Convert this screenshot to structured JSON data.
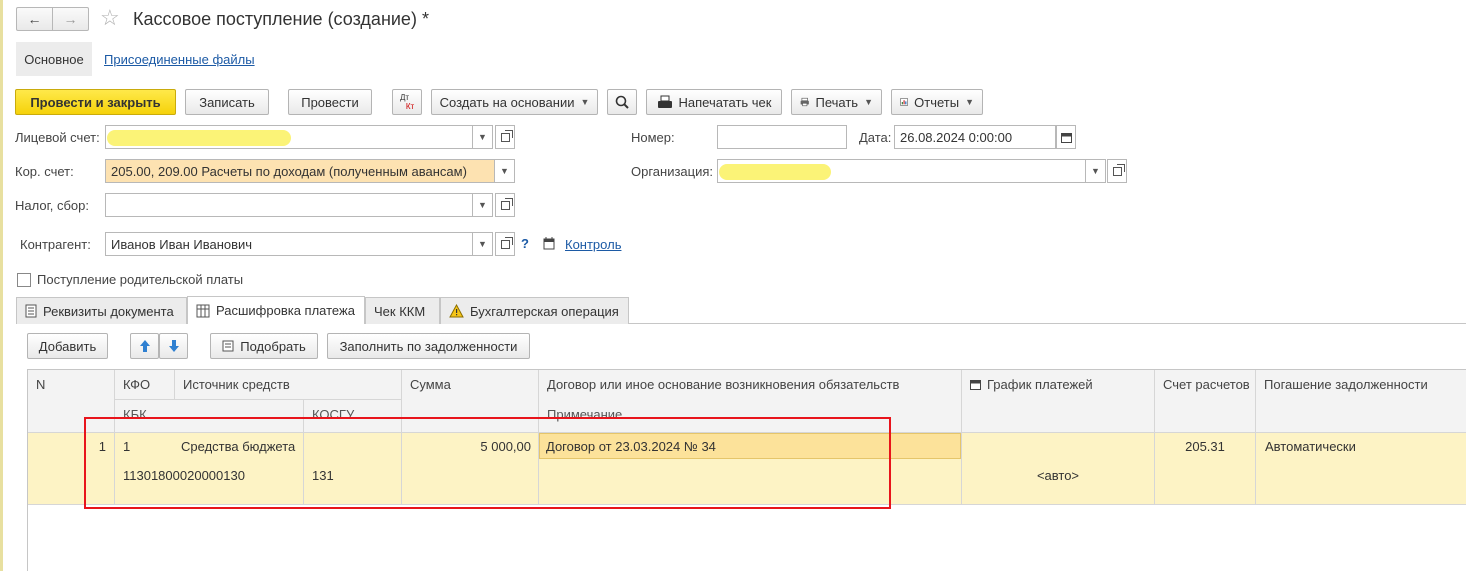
{
  "window": {
    "title": "Кассовое поступление (создание) *",
    "back": "←",
    "forward": "→",
    "star": "☆"
  },
  "sections": {
    "main": "Основное",
    "files": "Присоединенные файлы"
  },
  "toolbar": {
    "post_close": "Провести и закрыть",
    "save": "Записать",
    "post": "Провести",
    "dt_kt_top": "Дт",
    "dt_kt_bottom": "Кт",
    "create_based": "Создать на основании",
    "print_receipt": "Напечатать чек",
    "print": "Печать",
    "reports": "Отчеты"
  },
  "form": {
    "account_label": "Лицевой счет:",
    "account_value": "",
    "corr_label": "Кор. счет:",
    "corr_value": "205.00, 209.00 Расчеты по доходам (полученным авансам)",
    "tax_label": "Налог, сбор:",
    "tax_value": "",
    "counterparty_label": "Контрагент:",
    "counterparty_value": "Иванов Иван Иванович",
    "help": "?",
    "control_link": "Контроль",
    "number_label": "Номер:",
    "number_value": "",
    "date_label": "Дата:",
    "date_value": "26.08.2024  0:00:00",
    "org_label": "Организация:",
    "org_value": "",
    "parent_fee_label": "Поступление родительской платы"
  },
  "tabs": [
    {
      "label": "Реквизиты документа",
      "icon": "document-icon"
    },
    {
      "label": "Расшифровка платежа",
      "icon": "table-icon"
    },
    {
      "label": "Чек ККМ",
      "icon": ""
    },
    {
      "label": "Бухгалтерская операция",
      "icon": "warning-icon"
    }
  ],
  "table_toolbar": {
    "add": "Добавить",
    "pick": "Подобрать",
    "fill_debt": "Заполнить по задолженности"
  },
  "table": {
    "headers": {
      "n": "N",
      "kfo": "КФО",
      "source": "Источник средств",
      "kbk": "КБК",
      "kosgu": "КОСГУ",
      "sum": "Сумма",
      "contract": "Договор или иное основание возникновения обязательств",
      "note": "Примечание",
      "schedule": "График платежей",
      "account": "Счет расчетов",
      "repayment": "Погашение задолженности"
    },
    "rows": [
      {
        "n": "1",
        "kfo": "1",
        "source": "Средства бюджета",
        "kbk": "11301800020000130",
        "kosgu": "131",
        "sum": "5 000,00",
        "contract": "Договор от 23.03.2024 № 34",
        "note": "",
        "schedule": "<авто>",
        "account": "205.31",
        "repayment": "Автоматически"
      }
    ]
  },
  "colors": {
    "primary_button": "#f5d20a",
    "row_selected": "#fdf3c5",
    "orange_field": "#fde2b1",
    "annotation": "#e8141b",
    "link": "#1c5aa5"
  }
}
